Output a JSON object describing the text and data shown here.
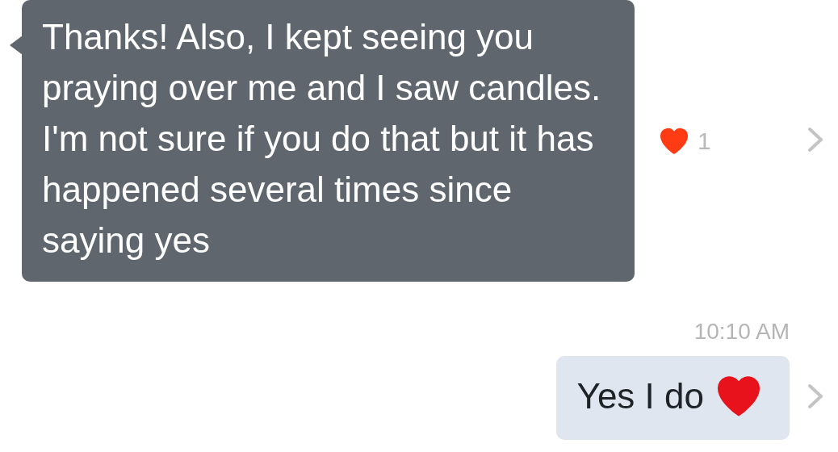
{
  "messages": [
    {
      "kind": "incoming",
      "text": "Thanks! Also, I kept seeing you praying over me and I saw candles. I'm not sure if you do that but it has happened several times since saying yes",
      "reaction": {
        "count": "1"
      }
    },
    {
      "kind": "timestamp",
      "text": "10:10 AM"
    },
    {
      "kind": "outgoing",
      "text": "Yes I do"
    }
  ]
}
